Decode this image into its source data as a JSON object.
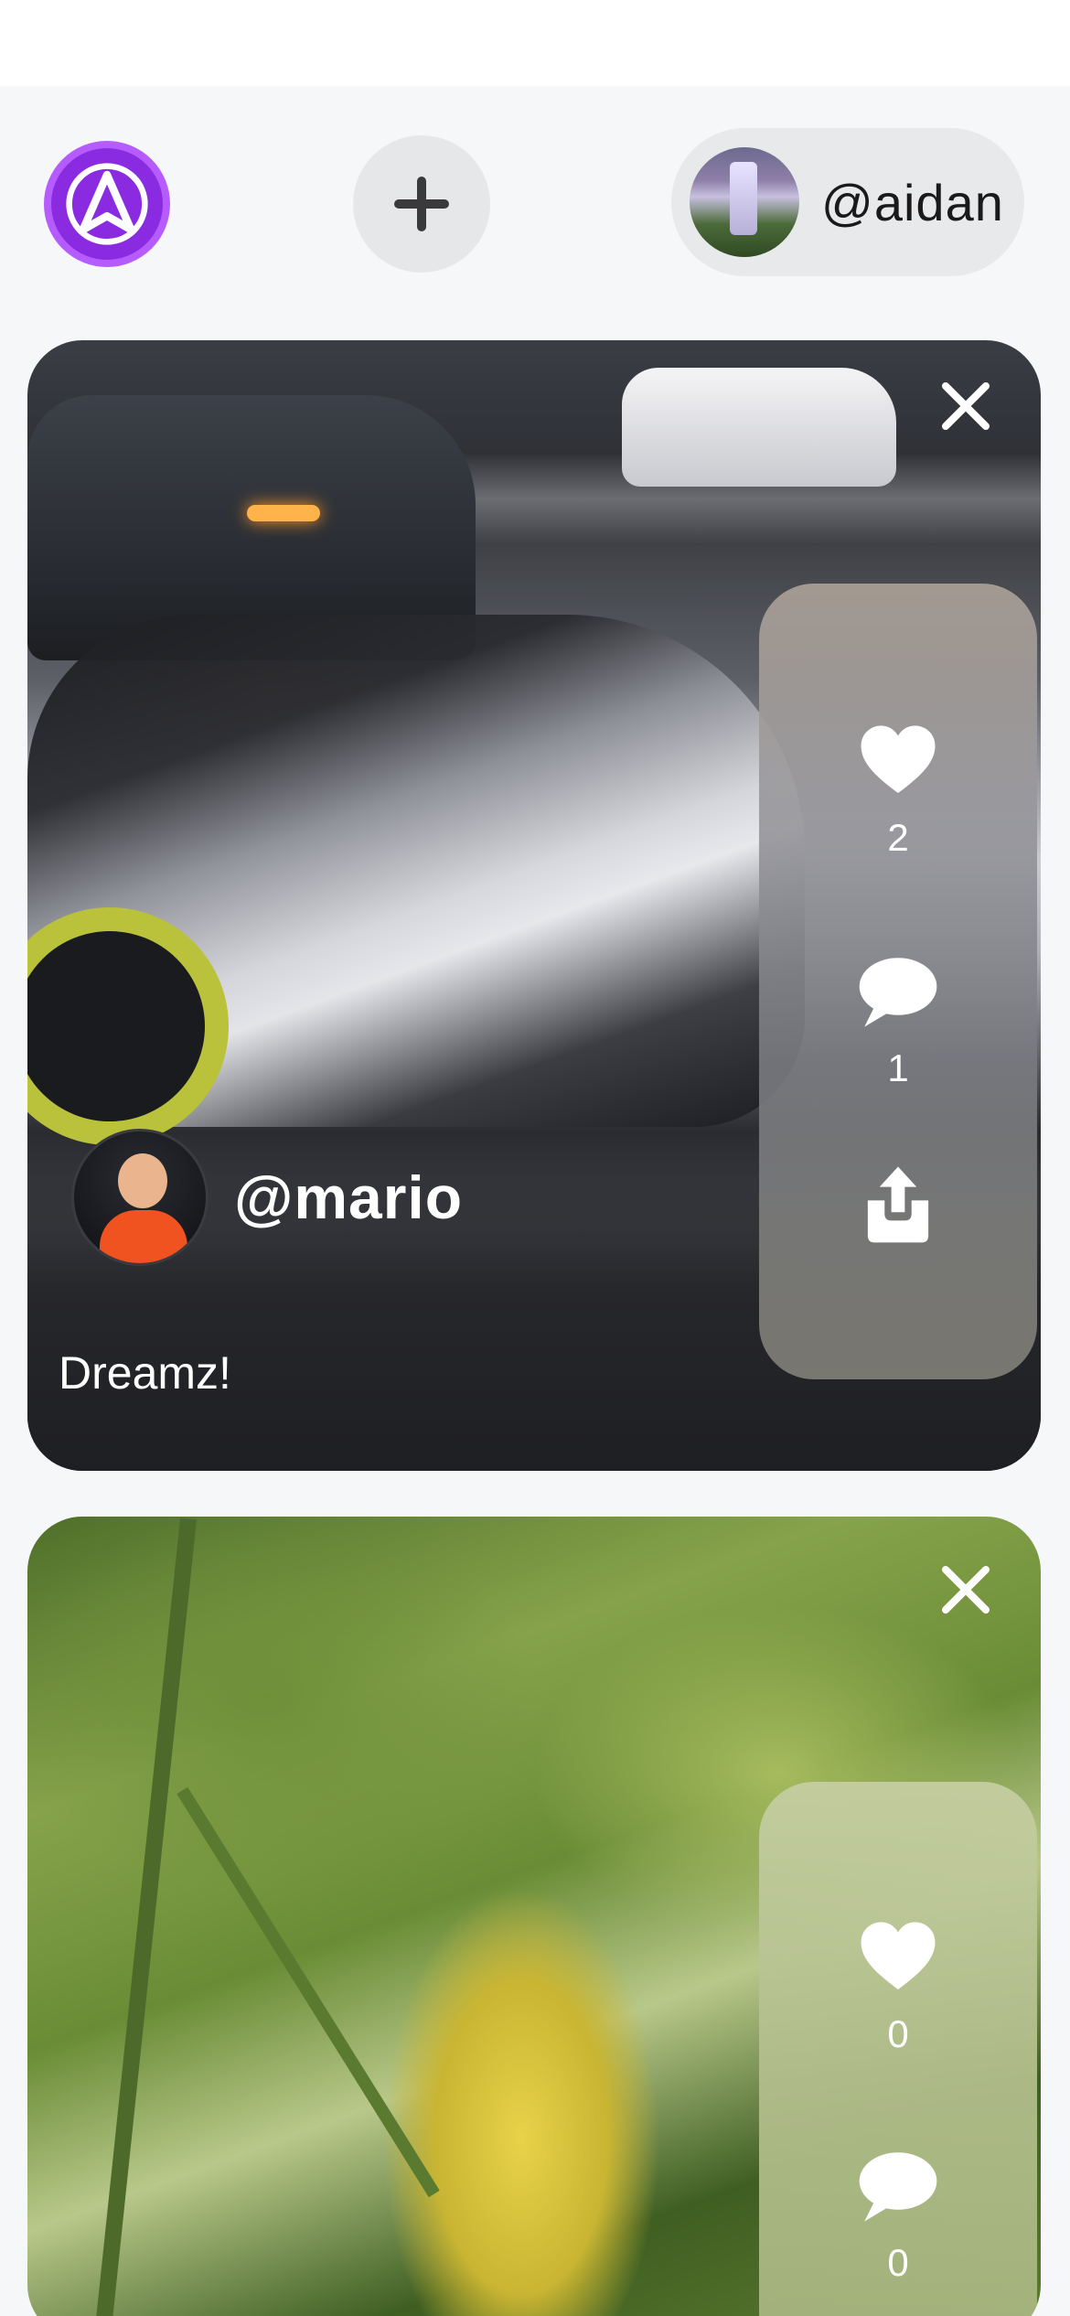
{
  "header": {
    "logo_icon": "brand-logo-icon",
    "add_icon": "plus-icon",
    "profile": {
      "username": "@aidan",
      "avatar": "waterfall-avatar"
    }
  },
  "colors": {
    "brand": "#8a2be2",
    "background": "#f6f7f9",
    "pill": "#e8e9eb"
  },
  "feed": [
    {
      "author": "@mario",
      "caption": "Dreamz!",
      "likes": "2",
      "comments": "1",
      "icons": [
        "close-icon",
        "heart-icon",
        "comment-icon",
        "share-icon"
      ]
    },
    {
      "likes": "0",
      "comments": "0",
      "icons": [
        "close-icon",
        "heart-icon",
        "comment-icon"
      ]
    }
  ]
}
